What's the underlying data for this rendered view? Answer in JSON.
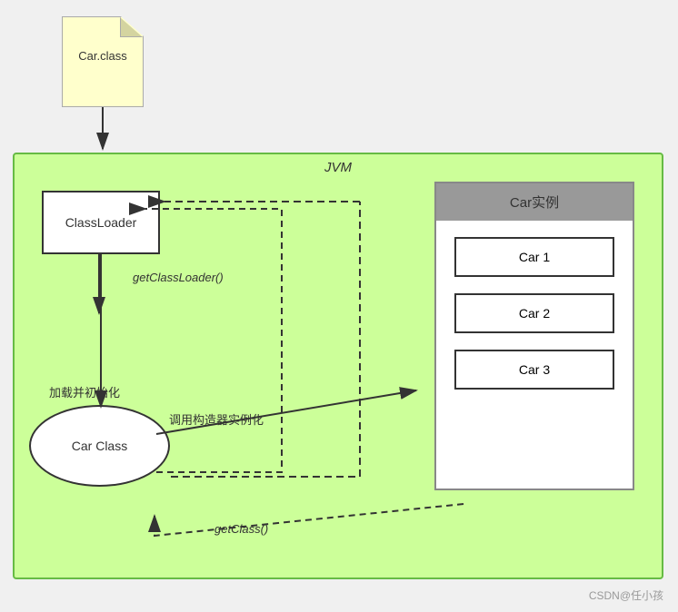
{
  "file": {
    "label": "Car.class"
  },
  "jvm": {
    "label": "JVM"
  },
  "classloader": {
    "label": "ClassLoader"
  },
  "carInstance": {
    "header": "Car实例",
    "items": [
      "Car 1",
      "Car 2",
      "Car 3"
    ]
  },
  "carClass": {
    "label": "Car Class"
  },
  "arrows": {
    "getClassLoader": "getClassLoader()",
    "loadAndInit": "加载并初始化",
    "invokeConstructor": "调用构造器实例化",
    "getClass": "getClass()"
  },
  "watermark": "CSDN@任小孩"
}
